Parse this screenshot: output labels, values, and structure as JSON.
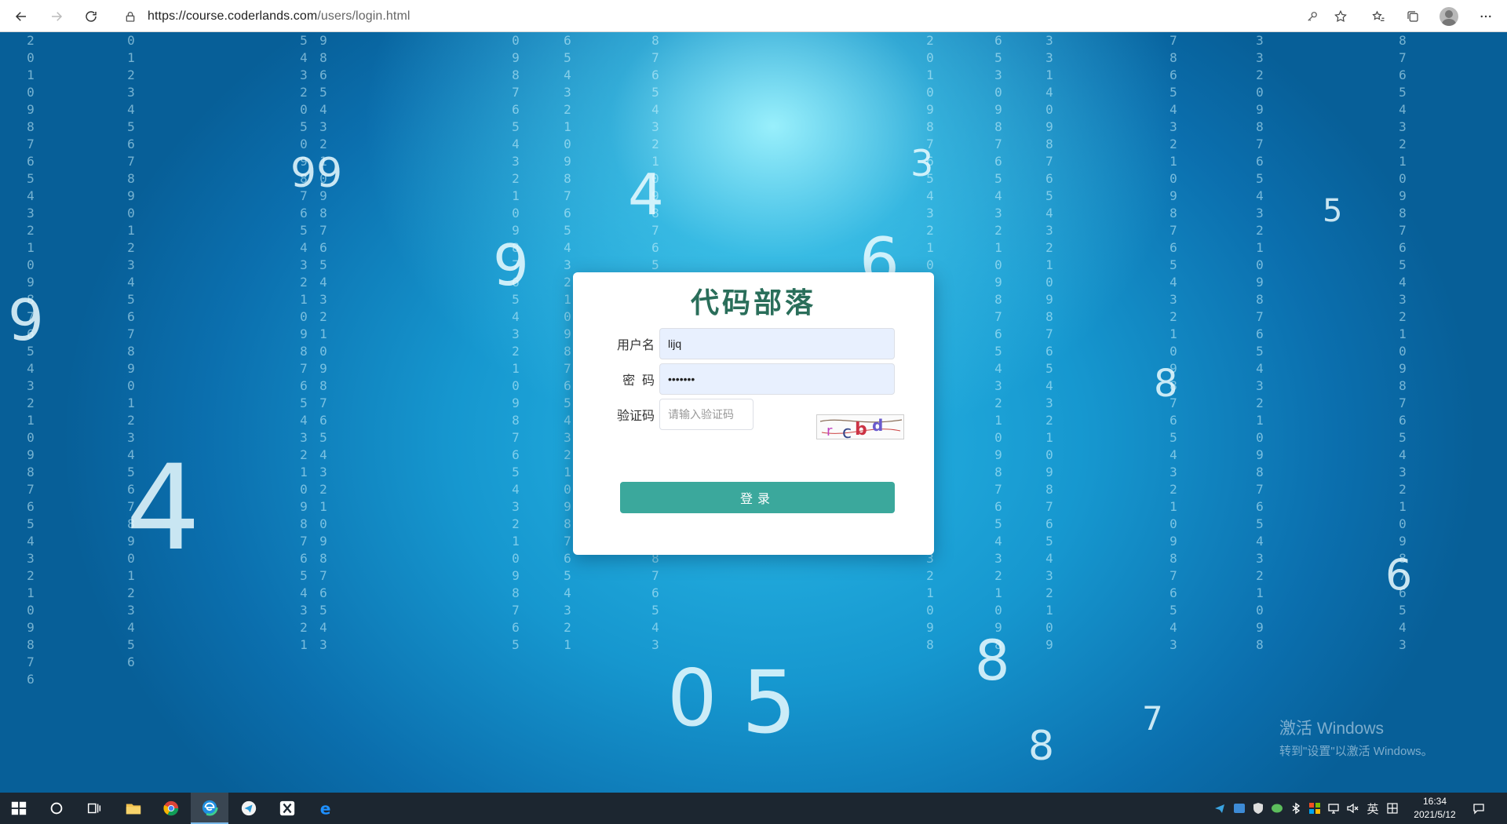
{
  "browser": {
    "url_host": "https://course.coderlands.com",
    "url_path": "/users/login.html"
  },
  "login": {
    "title": "代码部落",
    "username_label": "用户名",
    "username_value": "lijq",
    "password_label": "密  码",
    "password_value": "•••••••",
    "captcha_label": "验证码",
    "captcha_placeholder": "请输入验证码",
    "captcha_text": "rcbd",
    "submit_label": "登录"
  },
  "watermark": {
    "line1": "激活 Windows",
    "line2": "转到\"设置\"以激活 Windows。"
  },
  "taskbar": {
    "ime": "英",
    "time": "16:34",
    "date": "2021/5/12"
  },
  "colors": {
    "brand_title": "#2a6e5a",
    "button": "#3ba89c",
    "input_fill": "#e8f0fe"
  }
}
